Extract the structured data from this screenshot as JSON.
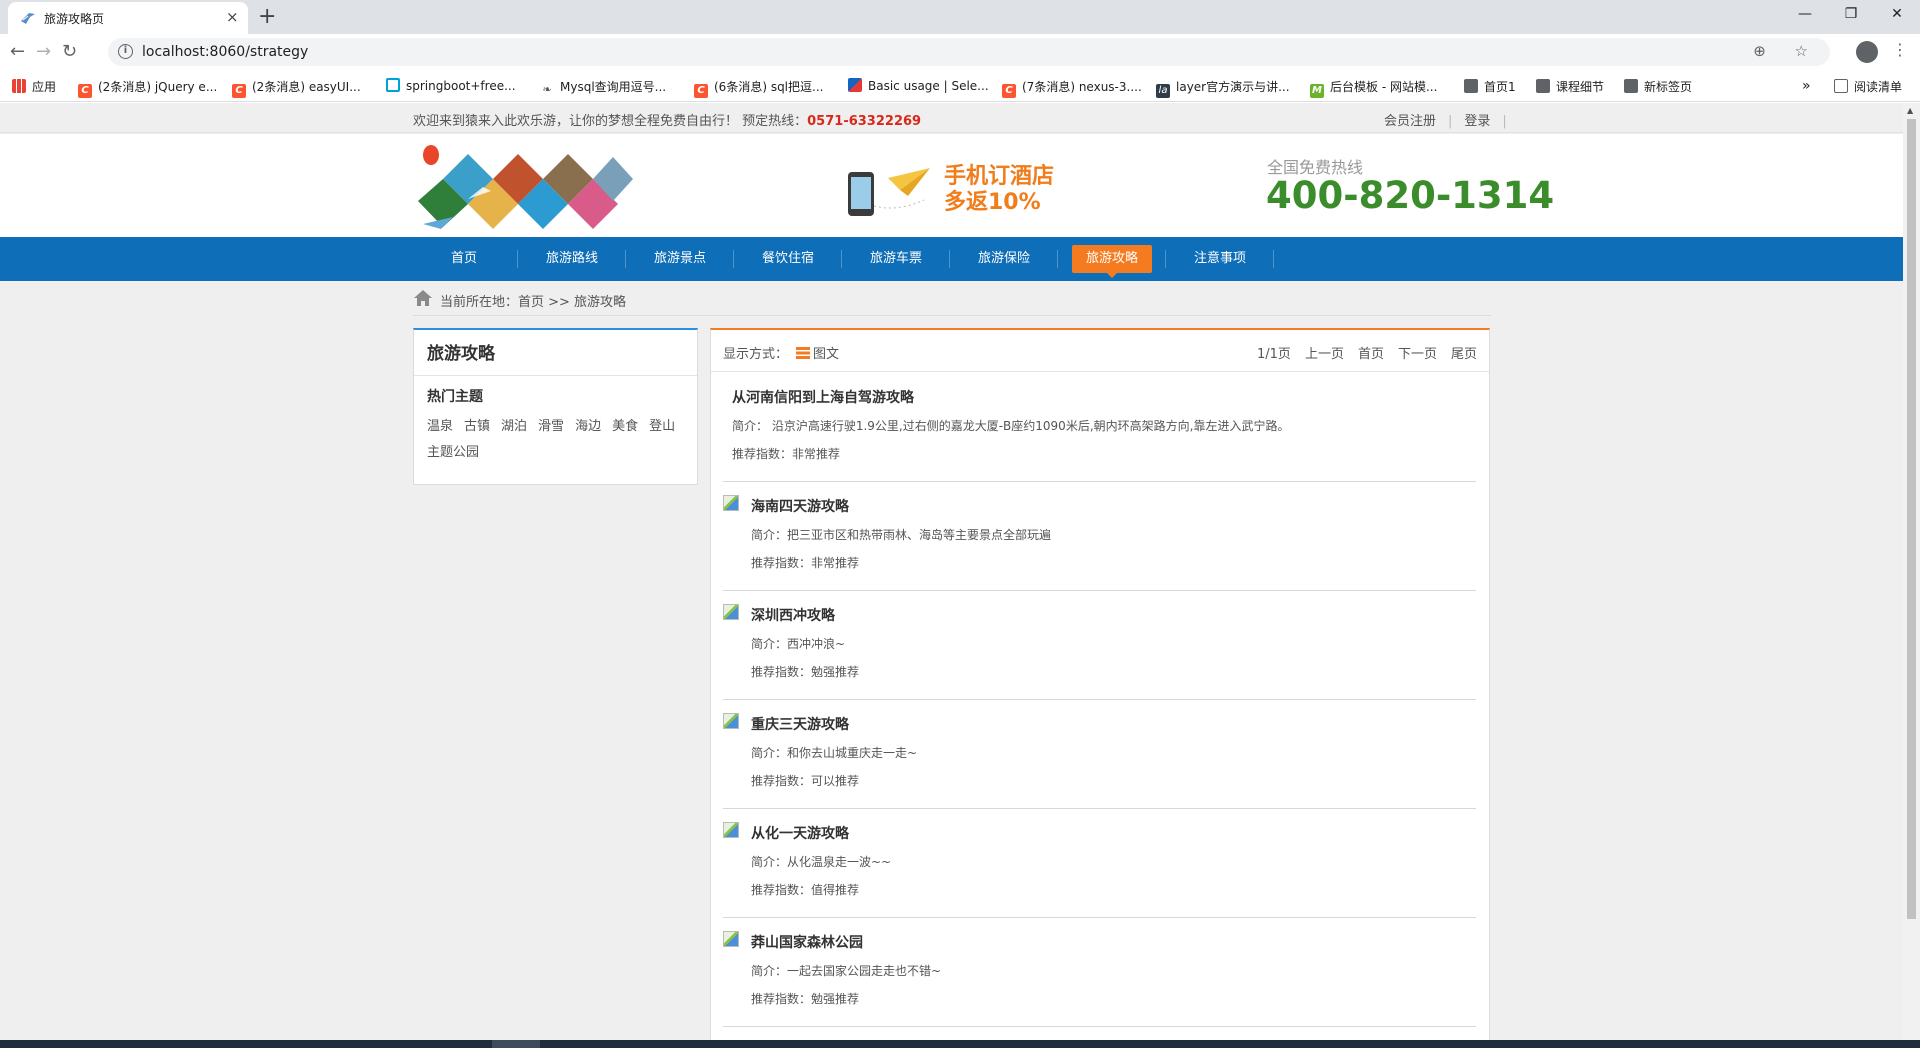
{
  "browser": {
    "tab_title": "旅游攻略页",
    "tab_close": "×",
    "new_tab": "+",
    "url": "localhost:8060/strategy",
    "controls": {
      "minimize": "—",
      "restore": "❐",
      "close": "✕"
    },
    "nav": {
      "back": "←",
      "forward": "→",
      "reload": "↻"
    },
    "omnibox_icons": "⊕ ☆",
    "menu": "⋮",
    "bookmarks": [
      {
        "icon": "apps-icon",
        "label": "应用"
      },
      {
        "icon": "csdn-icon",
        "label": "(2条消息) jQuery e..."
      },
      {
        "icon": "csdn-icon",
        "label": "(2条消息) easyUI..."
      },
      {
        "icon": "bilibili-icon",
        "label": "springboot+free..."
      },
      {
        "icon": "mysql-icon",
        "label": "Mysql查询用逗号..."
      },
      {
        "icon": "csdn-icon",
        "label": "(6条消息) sql把逗..."
      },
      {
        "icon": "selenium-icon",
        "label": "Basic usage | Sele..."
      },
      {
        "icon": "csdn-icon",
        "label": "(7条消息) nexus-3...."
      },
      {
        "icon": "layer-icon",
        "label": "layer官方演示与讲..."
      },
      {
        "icon": "m-icon",
        "label": "后台模板 - 网站模..."
      },
      {
        "icon": "globe-icon",
        "label": "首页1"
      },
      {
        "icon": "globe-icon",
        "label": "课程细节"
      },
      {
        "icon": "globe-icon",
        "label": "新标签页"
      }
    ],
    "overflow": "»",
    "reading_list": "阅读清单"
  },
  "site": {
    "welcome": "欢迎来到猿来入此欢乐游，让你的梦想全程免费自由行！ 预定热线：",
    "top_phone": "0571-63322269",
    "register": "会员注册",
    "login": "登录",
    "promo_line1": "手机订酒店",
    "promo_line2": "多返10%",
    "hotline_label": "全国免费热线",
    "hotline_number": "400-820-1314",
    "nav": [
      "首页",
      "旅游路线",
      "旅游景点",
      "餐饮住宿",
      "旅游车票",
      "旅游保险",
      "旅游攻略",
      "注意事项"
    ],
    "active_nav": "旅游攻略",
    "breadcrumb": "当前所在地：首页 >> 旅游攻略"
  },
  "sidebar": {
    "title": "旅游攻略",
    "subtitle": "热门主题",
    "tags": [
      "温泉",
      "古镇",
      "湖泊",
      "滑雪",
      "海边",
      "美食",
      "登山",
      "主题公园"
    ]
  },
  "content": {
    "display_label": "显示方式：",
    "display_mode": "图文",
    "pager": {
      "page": "1/1页",
      "prev": "上一页",
      "first": "首页",
      "next": "下一页",
      "last": "尾页"
    },
    "items": [
      {
        "title": "从河南信阳到上海自驾游攻略",
        "desc": "简介： 沿京沪高速行驶1.9公里,过右侧的嘉龙大厦-B座约1090米后,朝内环高架路方向,靠左进入武宁路。",
        "rec": "推荐指数：非常推荐"
      },
      {
        "title": "海南四天游攻略",
        "desc": "简介：把三亚市区和热带雨林、海岛等主要景点全部玩遍",
        "rec": "推荐指数：非常推荐"
      },
      {
        "title": "深圳西冲攻略",
        "desc": "简介：西冲冲浪~",
        "rec": "推荐指数：勉强推荐"
      },
      {
        "title": "重庆三天游攻略",
        "desc": "简介：和你去山城重庆走一走~",
        "rec": "推荐指数：可以推荐"
      },
      {
        "title": "从化一天游攻略",
        "desc": "简介：从化温泉走一波~~",
        "rec": "推荐指数：值得推荐"
      },
      {
        "title": "莽山国家森林公园",
        "desc": "简介：一起去国家公园走走也不错~",
        "rec": "推荐指数：勉强推荐"
      }
    ]
  },
  "colors": {
    "nav_blue": "#0f6eb8",
    "accent_orange": "#f57b20",
    "hotline_green": "#3b8c2a",
    "phone_red": "#d8281c"
  }
}
